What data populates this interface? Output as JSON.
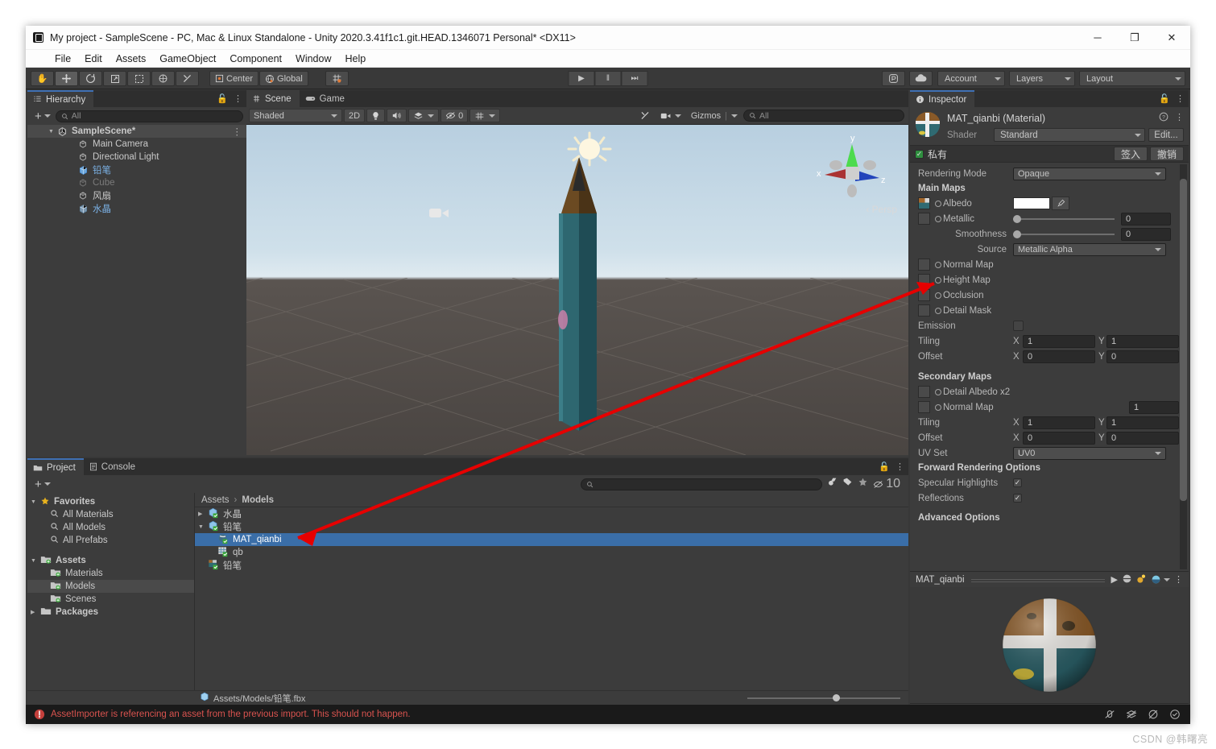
{
  "window": {
    "title": "My project - SampleScene - PC, Mac & Linux Standalone - Unity 2020.3.41f1c1.git.HEAD.1346071 Personal* <DX11>",
    "minimize": "─",
    "maximize": "❐",
    "close": "✕"
  },
  "menubar": {
    "items": [
      "File",
      "Edit",
      "Assets",
      "GameObject",
      "Component",
      "Window",
      "Help"
    ]
  },
  "toolbar": {
    "tools": [
      "hand-tool",
      "move-tool",
      "rotate-tool",
      "scale-tool",
      "rect-tool",
      "transform-tool",
      "custom-tool"
    ],
    "pivot_label": "Center",
    "handle_label": "Global",
    "grid_label": "grid-snap",
    "play": "▶",
    "pause": "‖",
    "step": "⏭",
    "collab_label": "collab-icon",
    "cloud_label": "cloud-icon",
    "account": "Account",
    "layers": "Layers",
    "layout": "Layout"
  },
  "hierarchy": {
    "tab": "Hierarchy",
    "search_placeholder": "All",
    "items": [
      {
        "label": "SampleScene*",
        "depth": 0,
        "style": "scene",
        "expanded": true
      },
      {
        "label": "Main Camera",
        "depth": 1,
        "style": "normal"
      },
      {
        "label": "Directional Light",
        "depth": 1,
        "style": "normal"
      },
      {
        "label": "铅笔",
        "depth": 1,
        "style": "prefab"
      },
      {
        "label": "Cube",
        "depth": 1,
        "style": "dim"
      },
      {
        "label": "风扇",
        "depth": 1,
        "style": "normal"
      },
      {
        "label": "水晶",
        "depth": 1,
        "style": "prefab"
      }
    ]
  },
  "scene": {
    "tabs": [
      {
        "label": "Scene",
        "active": true
      },
      {
        "label": "Game",
        "active": false
      }
    ],
    "draw_mode": "Shaded",
    "mode_2d": "2D",
    "lighting_icon": "lighting-toggle-icon",
    "audio_icon": "audio-toggle-icon",
    "fx_icon": "effects-toggle-icon",
    "hidden_count": "0",
    "grid_icon": "grid-visibility-icon",
    "tools_icon": "scene-tools-icon",
    "camera_icon": "scene-camera-icon",
    "gizmos": "Gizmos",
    "search_placeholder": "All",
    "gizmo_axes": {
      "x": "x",
      "y": "y",
      "z": "z"
    },
    "persp_label": "‹ Persp"
  },
  "project": {
    "tabs": [
      {
        "label": "Project",
        "active": true
      },
      {
        "label": "Console",
        "active": false
      }
    ],
    "search_placeholder": "",
    "filter_count": "10",
    "tree": [
      {
        "label": "Favorites",
        "depth": 0,
        "kind": "favorites",
        "expanded": true
      },
      {
        "label": "All Materials",
        "depth": 1,
        "kind": "search"
      },
      {
        "label": "All Models",
        "depth": 1,
        "kind": "search"
      },
      {
        "label": "All Prefabs",
        "depth": 1,
        "kind": "search"
      },
      {
        "label": "Assets",
        "depth": 0,
        "kind": "folder",
        "expanded": true
      },
      {
        "label": "Materials",
        "depth": 1,
        "kind": "folder"
      },
      {
        "label": "Models",
        "depth": 1,
        "kind": "folder",
        "selected": true
      },
      {
        "label": "Scenes",
        "depth": 1,
        "kind": "folder"
      },
      {
        "label": "Packages",
        "depth": 0,
        "kind": "folder-plain",
        "expanded": false
      }
    ],
    "breadcrumb": [
      "Assets",
      "Models"
    ],
    "assets": [
      {
        "label": "水晶",
        "depth": 0,
        "kind": "model",
        "expanded": false,
        "arrow": "▶"
      },
      {
        "label": "铅笔",
        "depth": 0,
        "kind": "model",
        "expanded": true,
        "arrow": "▼"
      },
      {
        "label": "MAT_qianbi",
        "depth": 1,
        "kind": "material",
        "selected": true
      },
      {
        "label": "qb",
        "depth": 1,
        "kind": "mesh"
      },
      {
        "label": "铅笔",
        "depth": 0,
        "kind": "texture"
      }
    ],
    "footer_path": "Assets/Models/铅笔.fbx"
  },
  "inspector": {
    "tab": "Inspector",
    "material_name": "MAT_qianbi (Material)",
    "shader_label": "Shader",
    "shader_value": "Standard",
    "edit_button": "Edit...",
    "private_label": "私有",
    "checkin_button": "签入",
    "revert_button": "撤销",
    "rendering_mode_label": "Rendering Mode",
    "rendering_mode_value": "Opaque",
    "main_maps_title": "Main Maps",
    "albedo_label": "Albedo",
    "metallic_label": "Metallic",
    "metallic_value": "0",
    "smoothness_label": "Smoothness",
    "smoothness_value": "0",
    "source_label": "Source",
    "source_value": "Metallic Alpha",
    "normal_map_label": "Normal Map",
    "height_map_label": "Height Map",
    "occlusion_label": "Occlusion",
    "detail_mask_label": "Detail Mask",
    "emission_label": "Emission",
    "tiling_label": "Tiling",
    "offset_label": "Offset",
    "x_label": "X",
    "y_label": "Y",
    "tiling_x": "1",
    "tiling_y": "1",
    "offset_x": "0",
    "offset_y": "0",
    "secondary_maps_title": "Secondary Maps",
    "detail_albedo_label": "Detail Albedo x2",
    "sec_normal_map_label": "Normal Map",
    "sec_normal_value": "1",
    "sec_tiling_x": "1",
    "sec_tiling_y": "1",
    "sec_offset_x": "0",
    "sec_offset_y": "0",
    "uv_set_label": "UV Set",
    "uv_set_value": "UV0",
    "forward_title": "Forward Rendering Options",
    "specular_label": "Specular Highlights",
    "reflections_label": "Reflections",
    "advanced_title": "Advanced Options",
    "check_glyph": "✓",
    "preview_name": "MAT_qianbi",
    "preview_play": "▶",
    "help_icon": "help-icon",
    "menu_icon": "kebab-menu-icon"
  },
  "statusbar": {
    "error_text": "AssetImporter is referencing an asset from the previous import. This should not happen.",
    "icons": [
      "no-bug-icon",
      "layers-off-icon",
      "no-eye-icon",
      "check-circle-icon"
    ]
  },
  "watermark": "CSDN @韩曙亮",
  "colors": {
    "accent_blue": "#3a6ea8",
    "error_red": "#d9534f",
    "arrow_red": "#e60000",
    "panel_bg": "#383838"
  }
}
